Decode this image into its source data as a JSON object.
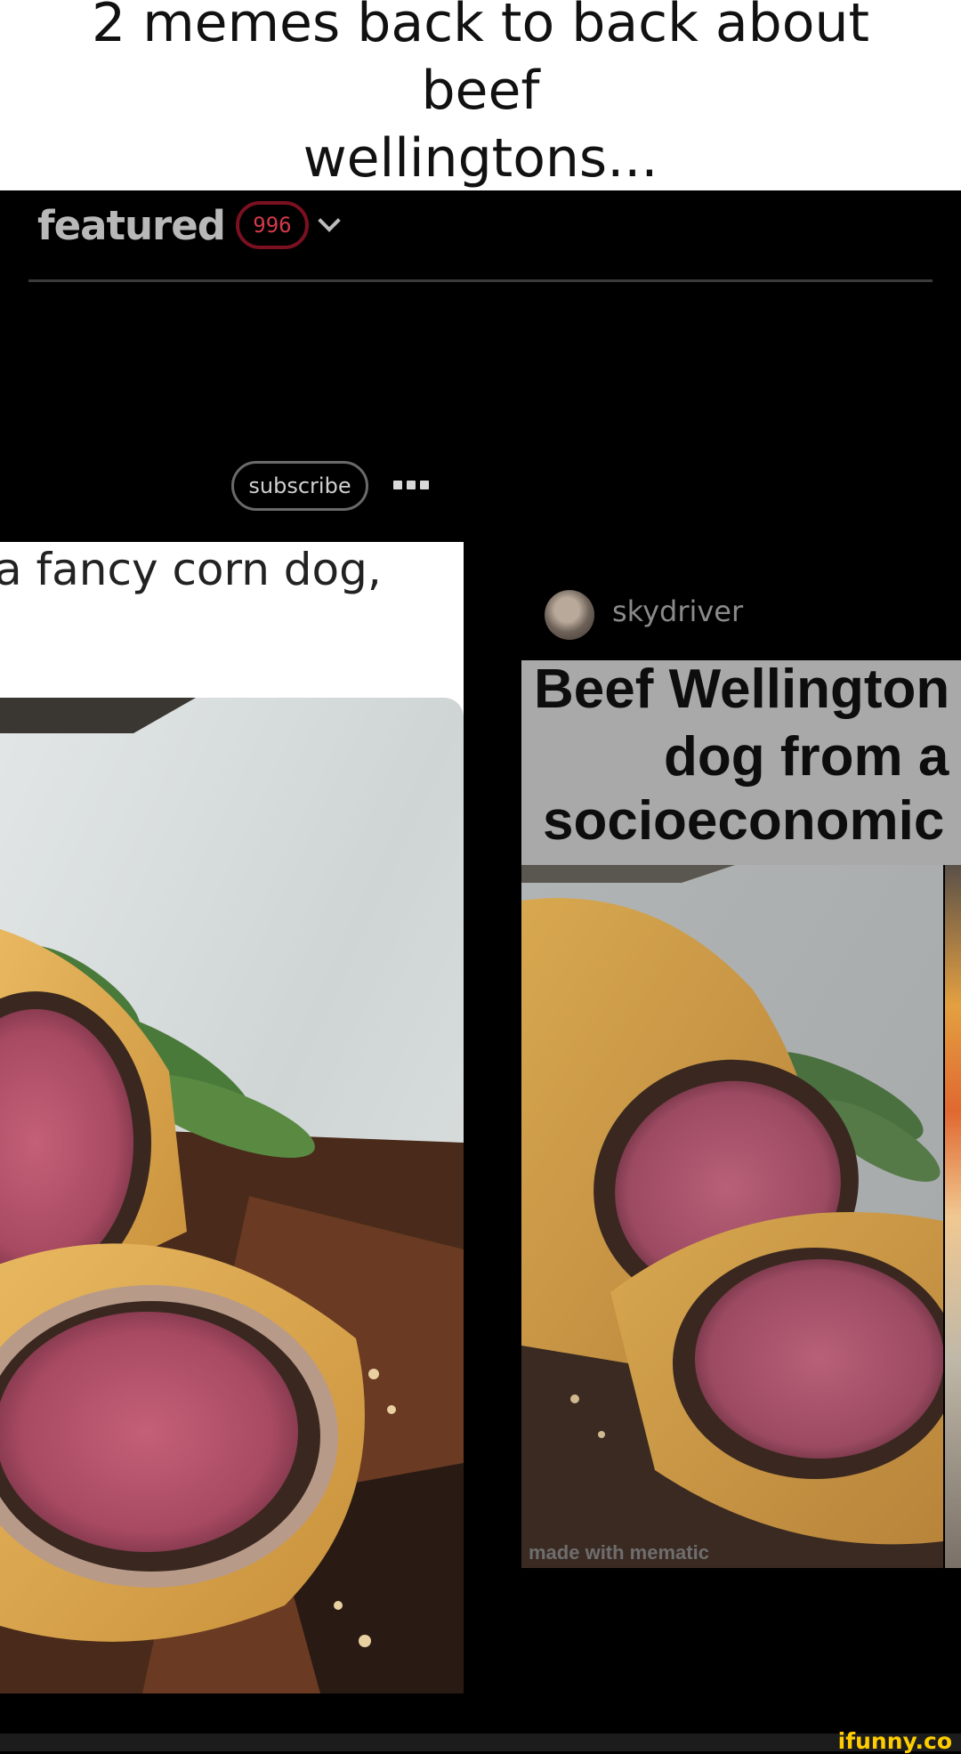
{
  "caption": {
    "line1": "2 memes back to back about beef",
    "line2": "wellingtons..."
  },
  "header": {
    "featured_label": "featured",
    "count": "996",
    "chevron_icon": "chevron-down-icon"
  },
  "post": {
    "subscribe_label": "subscribe",
    "more_icon": "more-dots-icon"
  },
  "left_meme": {
    "text": "a fancy corn dog,"
  },
  "right_meme": {
    "username": "skydriver",
    "lines": [
      "Beef Wellington",
      "dog from a",
      "socioeconomic"
    ],
    "watermark": "made with mematic"
  },
  "footer": {
    "logo": "ifunny.co"
  },
  "colors": {
    "badge": "#7a1020",
    "logo": "#ffcc00"
  }
}
